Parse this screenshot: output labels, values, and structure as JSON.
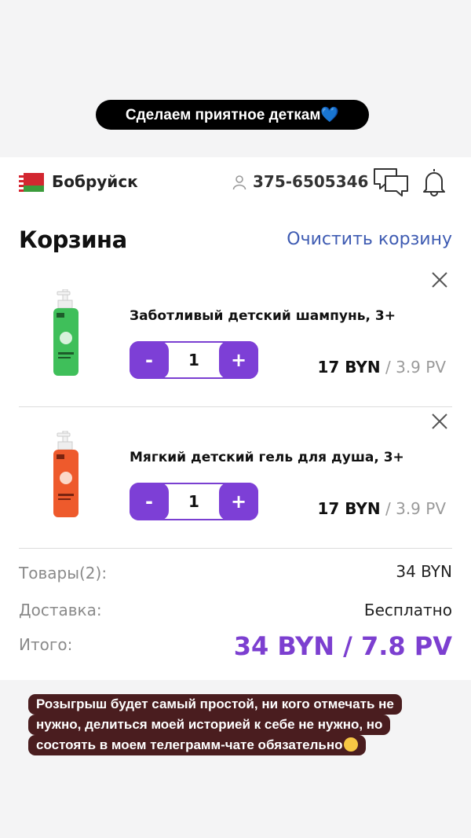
{
  "story": {
    "top_caption": "Сделаем приятное деткам💙",
    "bottom_lines": [
      "Розыгрыш будет самый простой, ни кого отмечать не",
      "нужно, делиться моей историей к себе не нужно, но",
      "состоять в моем телеграмм-чате обязательно"
    ],
    "emoji_icon": "pleading-face-emoji"
  },
  "header": {
    "city": "Бобруйск",
    "phone": "375-6505346",
    "icons": [
      "belarus-flag-icon",
      "person-icon",
      "chat-icon",
      "bell-icon"
    ]
  },
  "cart": {
    "title": "Корзина",
    "clear_label": "Очистить корзину",
    "items": [
      {
        "name": "Заботливый детский шампунь, 3+",
        "quantity": "1",
        "minus_label": "-",
        "plus_label": "+",
        "price": "17 BYN",
        "pv": " / 3.9 PV",
        "image": "green-shampoo-bottle",
        "color": "#3fbf5a"
      },
      {
        "name": "Мягкий детский гель для душа, 3+",
        "quantity": "1",
        "minus_label": "-",
        "plus_label": "+",
        "price": "17 BYN",
        "pv": " / 3.9 PV",
        "image": "orange-shower-gel-bottle",
        "color": "#ee5a2c"
      }
    ]
  },
  "summary": {
    "goods_label": "Товары(2):",
    "goods_value": "34 BYN",
    "delivery_label": "Доставка:",
    "delivery_value": "Бесплатно",
    "total_label": "Итого:",
    "total_value": "34 BYN / 7.8 PV"
  },
  "colors": {
    "accent": "#7d3fd6",
    "link": "#3e5bb2",
    "story_bg": "#4a1d1f"
  }
}
